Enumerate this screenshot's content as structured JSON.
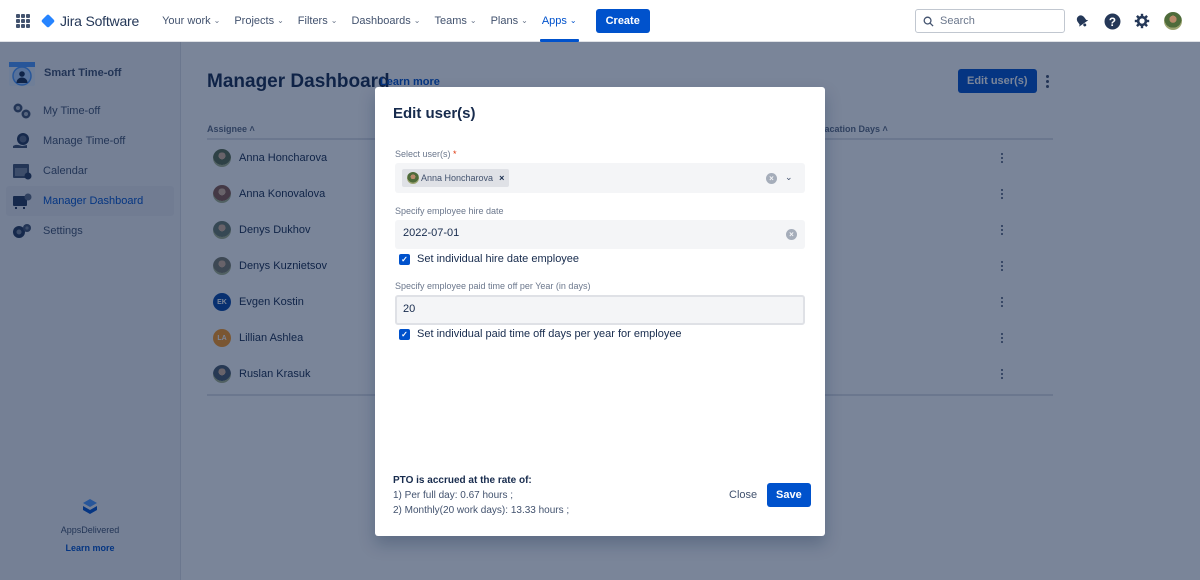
{
  "topbar": {
    "product_name": "Jira Software",
    "nav": [
      {
        "label": "Your work",
        "active": false
      },
      {
        "label": "Projects",
        "active": false
      },
      {
        "label": "Filters",
        "active": false
      },
      {
        "label": "Dashboards",
        "active": false
      },
      {
        "label": "Teams",
        "active": false
      },
      {
        "label": "Plans",
        "active": false
      },
      {
        "label": "Apps",
        "active": true
      }
    ],
    "create_label": "Create",
    "search_placeholder": "Search",
    "icons": [
      "notifications-icon",
      "help-icon",
      "settings-icon",
      "profile-avatar"
    ]
  },
  "sidebar": {
    "app_title": "Smart Time-off",
    "items": [
      {
        "label": "My Time-off",
        "icon": "my-timeoff-icon",
        "active": false
      },
      {
        "label": "Manage Time-off",
        "icon": "manage-timeoff-icon",
        "active": false
      },
      {
        "label": "Calendar",
        "icon": "calendar-icon",
        "active": false
      },
      {
        "label": "Manager Dashboard",
        "icon": "manager-dashboard-icon",
        "active": true
      },
      {
        "label": "Settings",
        "icon": "settings-icon",
        "active": false
      }
    ],
    "footer": {
      "brand": "AppsDelivered",
      "learn_more": "Learn more"
    }
  },
  "main": {
    "title": "Manager Dashboard",
    "learn_more": "Learn more",
    "edit_users_label": "Edit user(s)",
    "table": {
      "columns": [
        "Assignee ˄",
        "Vacation Days ˄"
      ],
      "rows": [
        {
          "name": "Anna Honcharova",
          "initials": "",
          "avatar_color": "#5b6b4a"
        },
        {
          "name": "Anna Konovalova",
          "initials": "",
          "avatar_color": "#8a5a4a"
        },
        {
          "name": "Denys Dukhov",
          "initials": "",
          "avatar_color": "#6b7a6a"
        },
        {
          "name": "Denys Kuznietsov",
          "initials": "",
          "avatar_color": "#7a7a6a"
        },
        {
          "name": "Evgen Kostin",
          "initials": "EK",
          "avatar_color": "#0747a6"
        },
        {
          "name": "Lillian Ashlea",
          "initials": "LA",
          "avatar_color": "#ff991f"
        },
        {
          "name": "Ruslan Krasuk",
          "initials": "",
          "avatar_color": "#4a5a6a"
        }
      ]
    }
  },
  "modal": {
    "title": "Edit user(s)",
    "select_users_label": "Select user(s)",
    "required_mark": "*",
    "selected_user": "Anna Honcharova",
    "chip_remove": "×",
    "hire_date_label": "Specify employee hire date",
    "hire_date_value": "2022-07-01",
    "hire_date_checkbox": {
      "label": "Set individual hire date employee",
      "checked": true
    },
    "pto_label": "Specify employee paid time off per Year (in days)",
    "pto_value": "20",
    "pto_checkbox": {
      "label": "Set individual paid time off days per year for employee",
      "checked": true
    },
    "accrual": {
      "heading": "PTO is accrued at the rate of:",
      "line1": "1) Per full day: 0.67 hours ;",
      "line2": "2) Monthly(20 work days): 13.33 hours ;"
    },
    "close_label": "Close",
    "save_label": "Save"
  }
}
